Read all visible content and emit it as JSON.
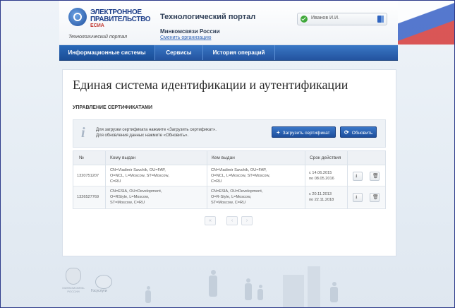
{
  "header": {
    "logo_line1": "ЭЛЕКТРОННОЕ",
    "logo_line2": "ПРАВИТЕЛЬСТВО",
    "logo_line3": "ЕСИА",
    "logo_subtitle": "Технологический портал",
    "portal_title": "Технологический портал",
    "ministry": "Минкомсвязи России",
    "change_org": "Сменить организацию",
    "user_name": "Иванов И.И."
  },
  "nav": {
    "items": [
      "Информационные системы",
      "Сервисы",
      "История операций"
    ],
    "active_index": 0
  },
  "main": {
    "title": "Единая система идентификации и аутентификации",
    "section_title": "УПРАВЛЕНИЕ СЕРТИФИКАТАМИ",
    "info_line1": "Для загрузки сертификата нажмите «Загрузить сертификат».",
    "info_line2": "Для обновления данных нажмите «Обновить».",
    "upload_label": "Загрузить сертификат",
    "refresh_label": "Обновить"
  },
  "table": {
    "headers": [
      "№",
      "Кому выдан",
      "Кем выдан",
      "Срок действия"
    ],
    "rows": [
      {
        "number": "1320751207",
        "issued_to": "CN=Vladimir Savchik, OU=FAP,\nO=NCL, L=Moscow, ST=Moscow,\nC=RU",
        "issued_by": "CN=Vladimir Savchik, OU=FAP,\nO=NCL, L=Moscow, ST=Moscow,\nC=RU",
        "validity": "с 14.06.2015\nпо 08.05.2016"
      },
      {
        "number": "1326527769",
        "issued_to": "CN=ESIA, OU=Development,\nO=RStyle, L=Moscow,\nST=Moscow, C=RU",
        "issued_by": "CN=ESIA, OU=Development,\nO=R-Style, L=Moscow,\nST=Moscow, C=RU",
        "validity": "с 20.11.2013\nпо 22.11.2018"
      }
    ]
  },
  "footer": {
    "emblem_text": "МИНКОМСВЯЗЬ РОССИИ",
    "gosuslugi": "Госуслуги"
  },
  "icons": {
    "user_status": "check-circle-icon",
    "logout": "logout-icon",
    "info": "info-icon",
    "upload": "plus-icon",
    "refresh": "refresh-icon",
    "download": "download-icon",
    "delete": "trash-icon",
    "first_page": "double-chevron-left-icon",
    "prev_page": "chevron-left-icon",
    "next_page": "chevron-right-icon"
  },
  "colors": {
    "nav_blue": "#23539f",
    "button_blue": "#2a63b4",
    "brand_red": "#c0342d",
    "success_green": "#3fa83a"
  }
}
